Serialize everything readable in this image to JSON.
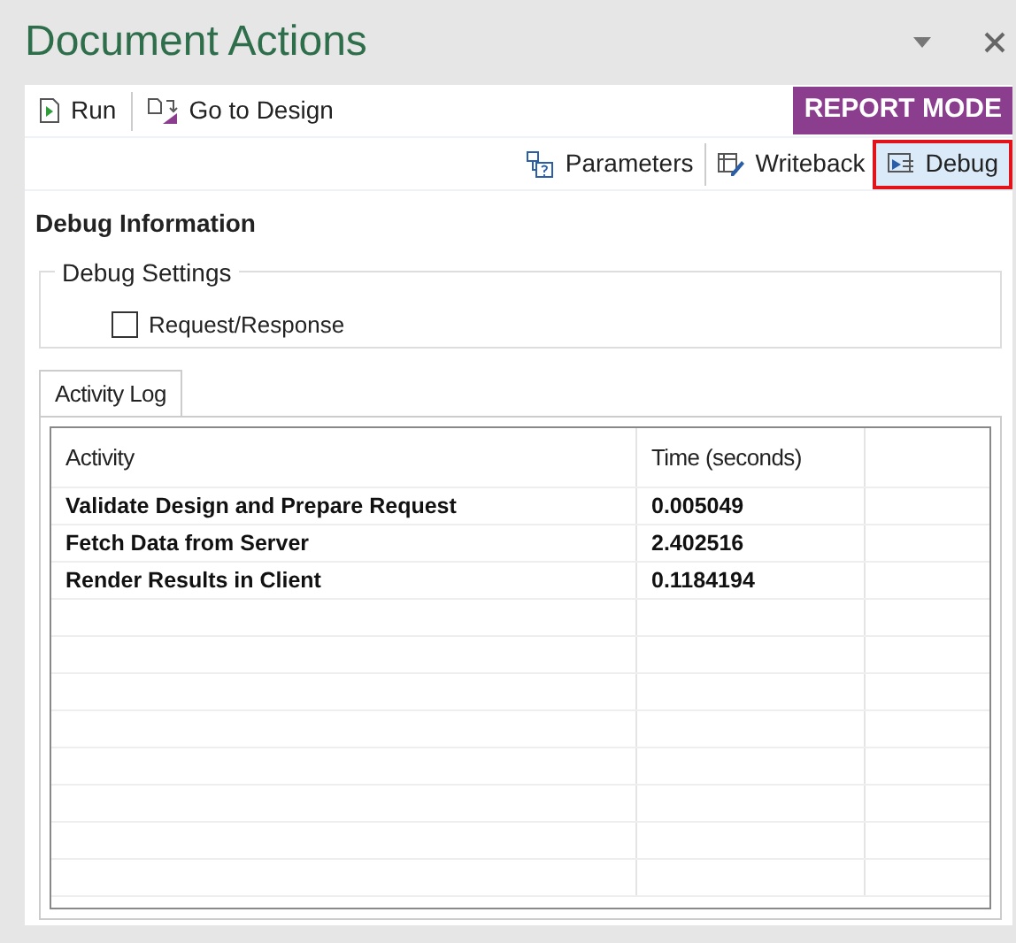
{
  "window": {
    "title": "Document Actions"
  },
  "toolbar": {
    "items": [
      {
        "label": "Run"
      },
      {
        "label": "Go to Design"
      }
    ],
    "mode_badge": "REPORT MODE"
  },
  "tabs": [
    {
      "label": "Parameters",
      "selected": false
    },
    {
      "label": "Writeback",
      "selected": false
    },
    {
      "label": "Debug",
      "selected": true
    }
  ],
  "section_title": "Debug Information",
  "settings": {
    "title": "Debug Settings",
    "options": [
      {
        "label": "Request/Response",
        "checked": false
      }
    ]
  },
  "log_tabs": [
    {
      "label": "Activity Log",
      "selected": true
    }
  ],
  "table": {
    "columns": [
      "Activity",
      "Time (seconds)"
    ],
    "rows": [
      [
        "Validate Design and Prepare Request",
        "0.005049"
      ],
      [
        "Fetch Data from Server",
        "2.402516"
      ],
      [
        "Render Results in Client",
        "0.1184194"
      ]
    ]
  }
}
